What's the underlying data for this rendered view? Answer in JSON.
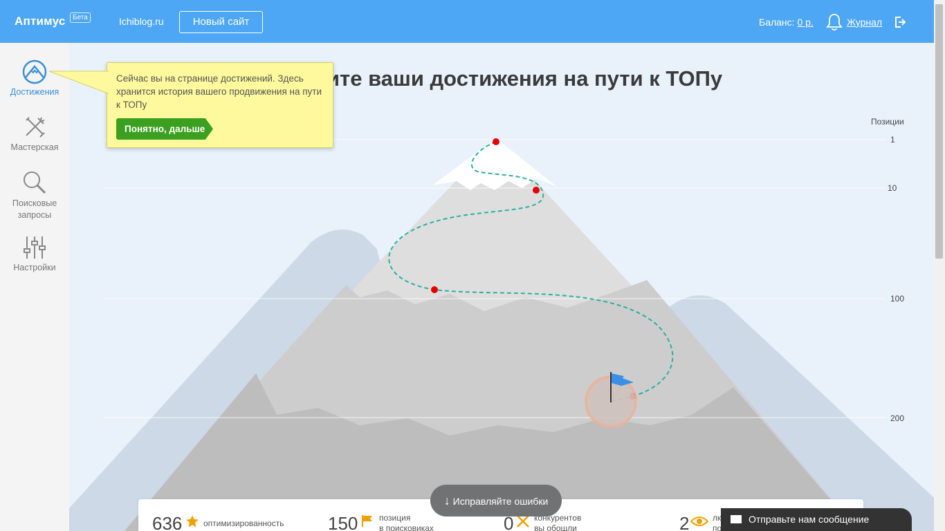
{
  "header": {
    "logo": "Аптимус",
    "beta": "Бета",
    "site": "Ichiblog.ru",
    "new_site_button": "Новый сайт",
    "balance_label": "Баланс:",
    "balance_value": "0 р.",
    "journal": "Журнал",
    "icons": [
      "bell-icon",
      "logout-icon"
    ]
  },
  "sidebar": {
    "items": [
      {
        "label": "Достижения",
        "icon": "mountain-icon",
        "active": true
      },
      {
        "label": "Мастерская",
        "icon": "tools-icon",
        "active": false
      },
      {
        "label": "Поисковые запросы",
        "icon": "search-icon",
        "active": false
      },
      {
        "label": "Настройки",
        "icon": "sliders-icon",
        "active": false
      }
    ]
  },
  "main": {
    "title": "ите ваши достижения на пути к ТОПу",
    "positions_label": "Позиции",
    "axis_ticks": [
      "1",
      "10",
      "100",
      "200"
    ]
  },
  "tooltip": {
    "text": "Сейчас вы на странице достижений. Здесь хранится история вашего продвижения на пути к ТОПу",
    "button": "Понятно, дальше"
  },
  "stats": [
    {
      "value": "636",
      "label": "оптимизированность",
      "icon": "star-icon"
    },
    {
      "value": "150",
      "label": "позиция\nв поисковиках",
      "icon": "flag-icon"
    },
    {
      "value": "0",
      "label": "конкурентов\nвы обошли",
      "icon": "cross-icon"
    },
    {
      "value": "2",
      "label": "лк\nпо",
      "icon": "eye-icon"
    }
  ],
  "fix_errors_button": "Исправляйте ошибки",
  "message_button": "Отправьте нам сообщение",
  "colors": {
    "topbar": "#4da7f4",
    "accent": "#3a8fd8",
    "tooltip_bg": "#fdf99c",
    "tooltip_button": "#3ba020",
    "path_dots": "#e60000",
    "path_line": "#2ab0a0"
  }
}
